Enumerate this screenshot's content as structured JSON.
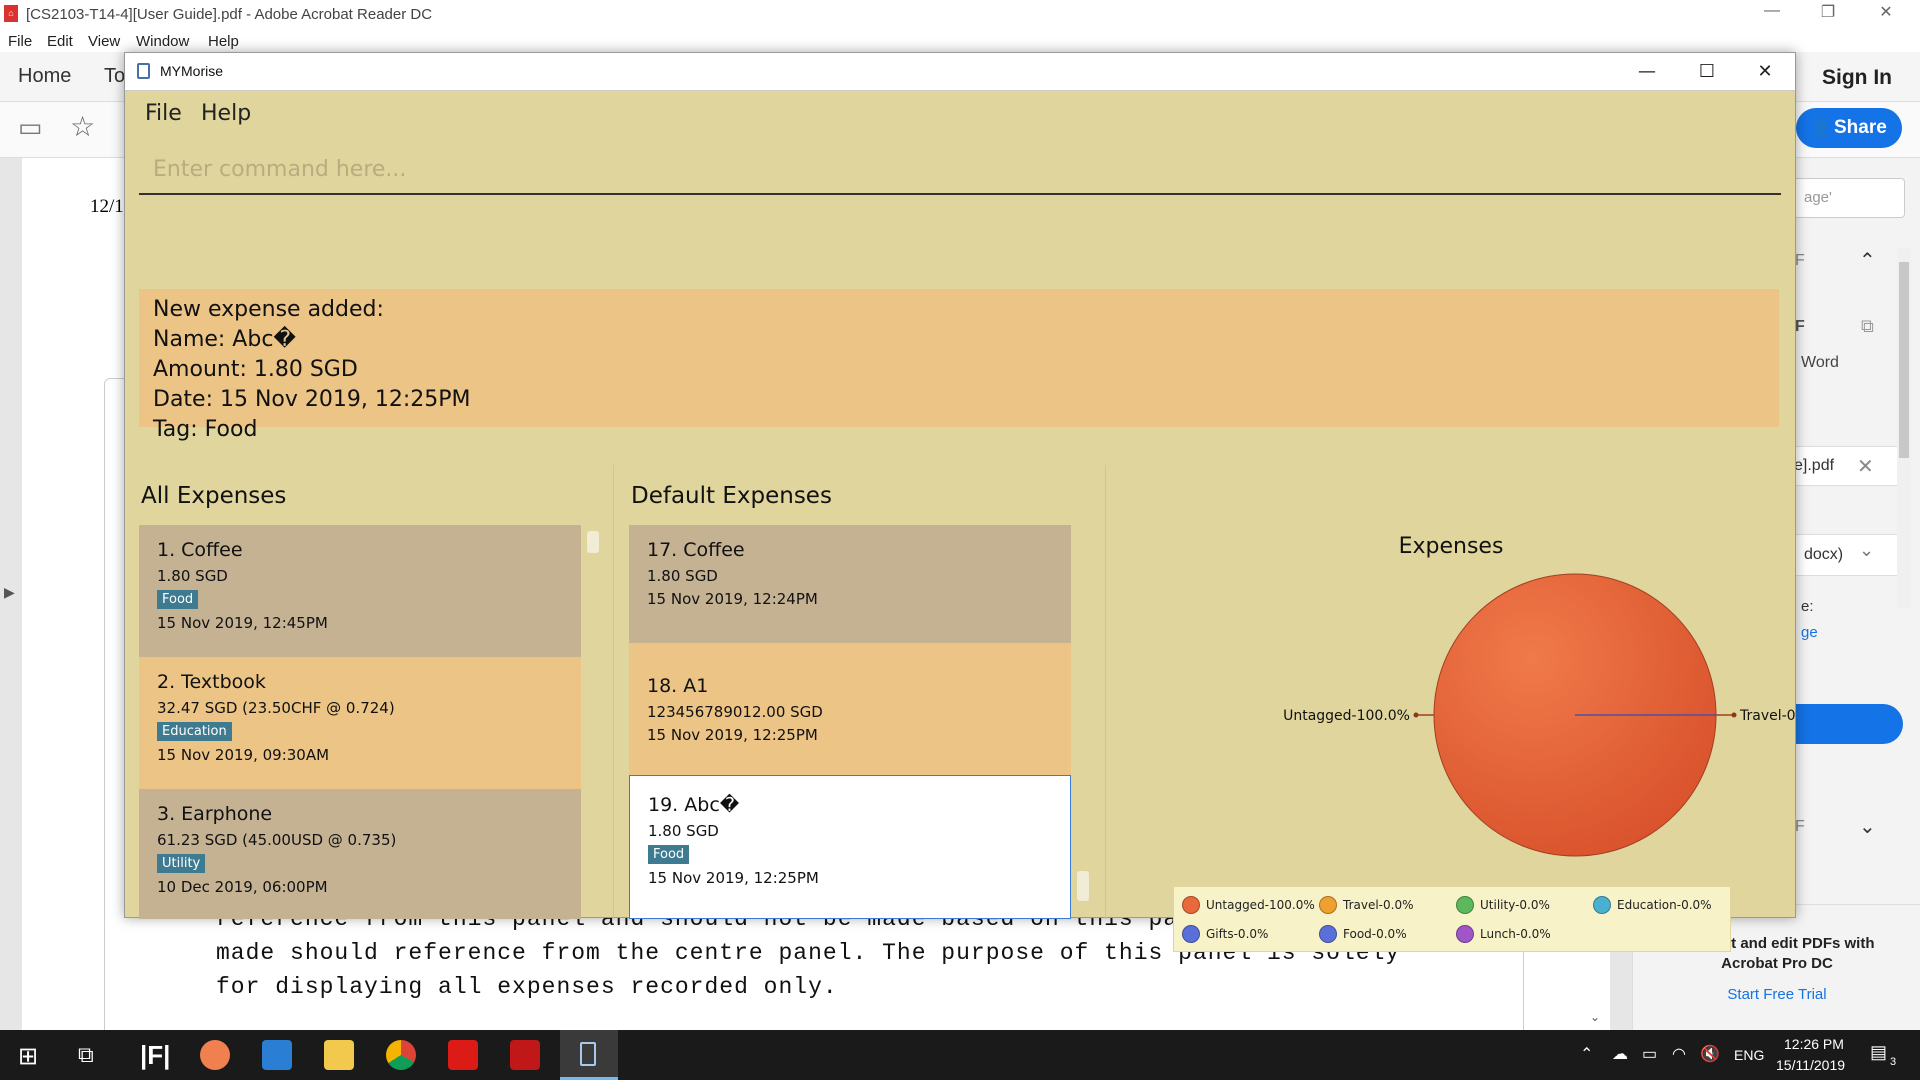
{
  "acrobat": {
    "title": "[CS2103-T14-4][User Guide].pdf - Adobe Acrobat Reader DC",
    "menu": [
      "File",
      "Edit",
      "View",
      "Window",
      "Help"
    ],
    "tab_home": "Home",
    "tab_tools_partial": "To",
    "sign_in": "Sign In",
    "share": "Share",
    "doc_left_partial": "12/1",
    "doc_lines": [
      "reference from this panel and should not be made based on this panel. Commands",
      "made should reference from the centre panel. The purpose of this panel is solely",
      "for displaying all expenses recorded only."
    ],
    "right_panel": {
      "search_partial": "age'",
      "f1": "F",
      "f2": "F",
      "word": "Word",
      "file_partial": "e].pdf",
      "docx_partial": "docx)",
      "e_partial": "e:",
      "ge_partial": "ge",
      "f3": "F",
      "promo": "Convert and edit PDFs with Acrobat Pro DC",
      "trial": "Start Free Trial"
    }
  },
  "taskbar": {
    "time": "12:26 PM",
    "date": "15/11/2019",
    "lang": "ENG",
    "notif": "3"
  },
  "app": {
    "title": "MYMorise",
    "menu": {
      "file": "File",
      "help": "Help"
    },
    "command_placeholder": "Enter command here...",
    "result_lines": [
      "New expense added:",
      "Name: Abc�",
      "Amount: 1.80 SGD",
      "Date: 15 Nov 2019, 12:25PM",
      "Tag: Food"
    ],
    "all_expenses": {
      "title": "All Expenses",
      "items": [
        {
          "name": "1.  Coffee",
          "amount": "1.80 SGD",
          "tag": "Food",
          "date": "15 Nov 2019, 12:45PM",
          "bg": "#c4b293"
        },
        {
          "name": "2.  Textbook",
          "amount": "32.47 SGD (23.50CHF @ 0.724)",
          "tag": "Education",
          "date": "15 Nov 2019, 09:30AM",
          "bg": "#ecc486"
        },
        {
          "name": "3.  Earphone",
          "amount": "61.23 SGD (45.00USD @ 0.735)",
          "tag": "Utility",
          "date": "10 Dec 2019, 06:00PM",
          "bg": "#c4b293"
        }
      ]
    },
    "default_expenses": {
      "title": "Default Expenses",
      "items": [
        {
          "name": "17.  Coffee",
          "amount": "1.80 SGD",
          "date": "15 Nov 2019, 12:24PM",
          "bg": "#c4b293"
        },
        {
          "name": "18.  A1",
          "amount": "123456789012.00 SGD",
          "date": "15 Nov 2019, 12:25PM",
          "bg": "#ecc486"
        },
        {
          "name": "19.  Abc�",
          "amount": "1.80 SGD",
          "tag": "Food",
          "date": "15 Nov 2019, 12:25PM",
          "bg": "#ffffff"
        }
      ]
    },
    "chart_data": {
      "type": "pie",
      "title": "Expenses",
      "slices": [
        {
          "label": "Untagged-100.0%",
          "value": 100.0,
          "color": "#e8693a"
        },
        {
          "label": "Travel-0.0%",
          "value": 0.0,
          "color": "#f0a030"
        }
      ],
      "legend": [
        {
          "label": "Untagged-100.0%",
          "color": "#e8693a"
        },
        {
          "label": "Travel-0.0%",
          "color": "#f0a030"
        },
        {
          "label": "Utility-0.0%",
          "color": "#5cb85c"
        },
        {
          "label": "Education-0.0%",
          "color": "#4ab0d0"
        },
        {
          "label": "Gifts-0.0%",
          "color": "#5b6fd8"
        },
        {
          "label": "Food-0.0%",
          "color": "#5b6fd8"
        },
        {
          "label": "Lunch-0.0%",
          "color": "#a055c8"
        }
      ],
      "legend_position": "bottom"
    }
  }
}
